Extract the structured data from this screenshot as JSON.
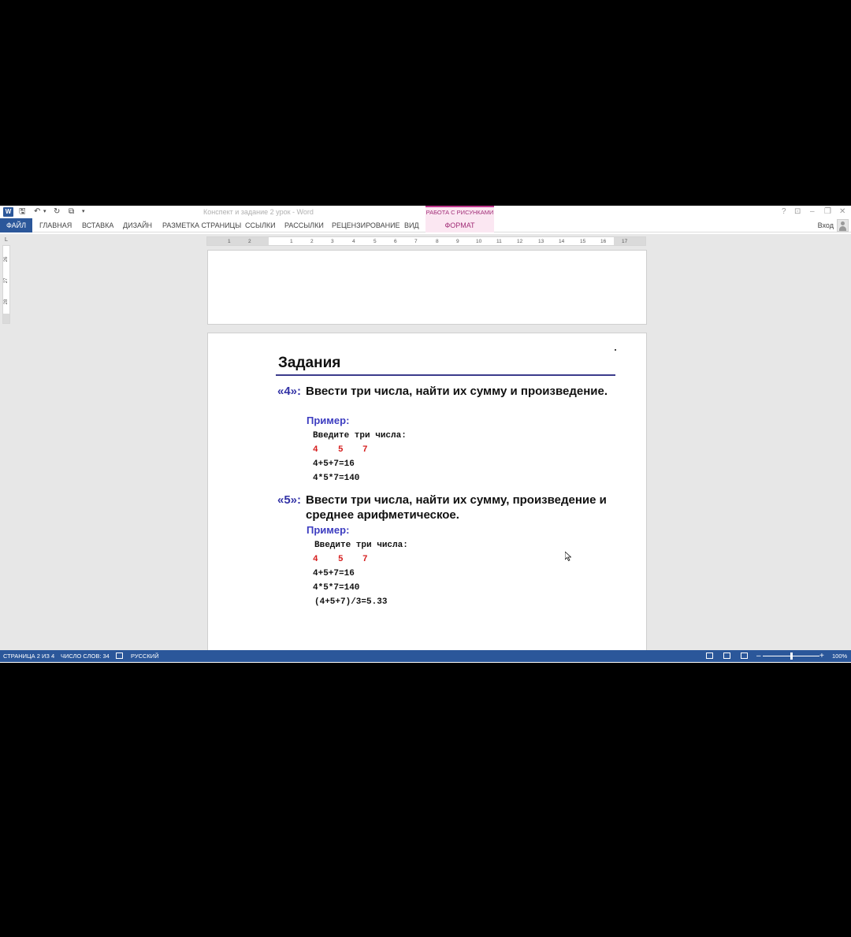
{
  "window": {
    "app_icon_label": "W",
    "doc_title": "Конспект и задание 2 урок - Word",
    "context_group_title": "РАБОТА С РИСУНКАМИ",
    "help_glyph": "?",
    "ribbon_display_glyph": "⊡",
    "minimize_glyph": "–",
    "restore_glyph": "❐",
    "close_glyph": "✕"
  },
  "quick_access": {
    "save_glyph": "🖫",
    "undo_glyph": "↶",
    "undo_dropdown_glyph": "▾",
    "redo_glyph": "↻",
    "touch_glyph": "⧉",
    "customize_glyph": "▾"
  },
  "ribbon": {
    "tabs": [
      {
        "id": "file",
        "label": "ФАЙЛ"
      },
      {
        "id": "home",
        "label": "ГЛАВНАЯ"
      },
      {
        "id": "insert",
        "label": "ВСТАВКА"
      },
      {
        "id": "design",
        "label": "ДИЗАЙН"
      },
      {
        "id": "layout",
        "label": "РАЗМЕТКА СТРАНИЦЫ"
      },
      {
        "id": "references",
        "label": "ССЫЛКИ"
      },
      {
        "id": "mailings",
        "label": "РАССЫЛКИ"
      },
      {
        "id": "review",
        "label": "РЕЦЕНЗИРОВАНИЕ"
      },
      {
        "id": "view",
        "label": "ВИД"
      },
      {
        "id": "format",
        "label": "ФОРМАТ"
      }
    ],
    "signin_label": "Вход"
  },
  "rulers": {
    "tab_selector_glyph": "L",
    "horizontal_left": [
      "1",
      "2",
      "1"
    ],
    "horizontal_right": [
      "1",
      "2",
      "3",
      "4",
      "5",
      "6",
      "7",
      "8",
      "9",
      "10",
      "11",
      "12",
      "13",
      "14",
      "15",
      "16",
      "17"
    ],
    "vertical": [
      "26",
      "27",
      "28"
    ]
  },
  "document": {
    "slide_title": "Задания",
    "tasks": [
      {
        "number": "«4»:",
        "text": "Ввести три числа, найти их сумму и произведение.",
        "example_label": "Пример:",
        "prompt": "Введите три числа:",
        "inputs": [
          "4",
          "5",
          "7"
        ],
        "outputs": [
          "4+5+7=16",
          "4*5*7=140"
        ]
      },
      {
        "number": "«5»:",
        "text": "Ввести три числа, найти их сумму, произведение и среднее арифметическое.",
        "example_label": "Пример:",
        "prompt": "Введите три числа:",
        "inputs": [
          "4",
          "5",
          "7"
        ],
        "outputs": [
          "4+5+7=16",
          "4*5*7=140",
          "(4+5+7)/3=5.33"
        ]
      }
    ]
  },
  "statusbar": {
    "page": "СТРАНИЦА 2 ИЗ 4",
    "words": "ЧИСЛО СЛОВ: 34",
    "language": "РУССКИЙ",
    "zoom_minus": "–",
    "zoom_plus": "+",
    "zoom_level": "100%",
    "zoom_fraction": 0.5
  },
  "colors": {
    "brand": "#2b579a",
    "context_tab": "#a12d77",
    "task_number": "#3333a6",
    "example_label": "#3c3cc0",
    "input_numbers": "#d61f1f",
    "title_rule": "#3c3c8c"
  }
}
